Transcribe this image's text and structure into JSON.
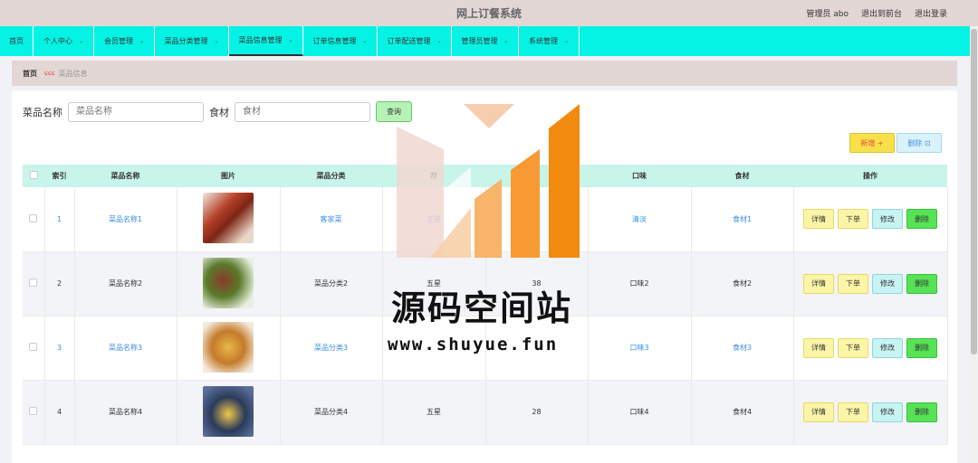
{
  "app_title": "网上订餐系统",
  "header": {
    "admin": "管理员 abo",
    "front": "退出到前台",
    "logout": "退出登录"
  },
  "nav": [
    {
      "label": "首页"
    },
    {
      "label": "个人中心"
    },
    {
      "label": "会员管理"
    },
    {
      "label": "菜品分类管理"
    },
    {
      "label": "菜品信息管理"
    },
    {
      "label": "订单信息管理"
    },
    {
      "label": "订单配送管理"
    },
    {
      "label": "管理员管理"
    },
    {
      "label": "系统管理"
    }
  ],
  "breadcrumb": {
    "home": "首页",
    "current": "菜品信息"
  },
  "search": {
    "label1": "菜品名称",
    "placeholder1": "菜品名称",
    "label2": "食材",
    "placeholder2": "食材",
    "button": "查询"
  },
  "actions": {
    "add": "新增 +",
    "delete": "删除 ⊡"
  },
  "table": {
    "headers": [
      "",
      "索引",
      "菜品名称",
      "图片",
      "菜品分类",
      "荐",
      "",
      "口味",
      "食材",
      "操作"
    ],
    "rows": [
      {
        "index": "1",
        "name": "菜品名称1",
        "category": "客家菜",
        "rec": "五星",
        "num": "",
        "taste": "清淡",
        "ingredient": "食材1"
      },
      {
        "index": "2",
        "name": "菜品名称2",
        "category": "菜品分类2",
        "rec": "五星",
        "num": "38",
        "taste": "口味2",
        "ingredient": "食材2"
      },
      {
        "index": "3",
        "name": "菜品名称3",
        "category": "菜品分类3",
        "rec": "",
        "num": "",
        "taste": "口味3",
        "ingredient": "食材3"
      },
      {
        "index": "4",
        "name": "菜品名称4",
        "category": "菜品分类4",
        "rec": "五星",
        "num": "28",
        "taste": "口味4",
        "ingredient": "食材4"
      }
    ],
    "ops": {
      "detail": "详情",
      "order": "下单",
      "edit": "修改",
      "delete": "删除"
    }
  },
  "watermark": {
    "text": "源码空间站",
    "url": "www.shuyue.fun"
  },
  "colors": {
    "nav_bg": "#05f3e4",
    "header_bg": "#e2d7d5",
    "table_head": "#c9f4ea",
    "link": "#3a8ee6"
  }
}
